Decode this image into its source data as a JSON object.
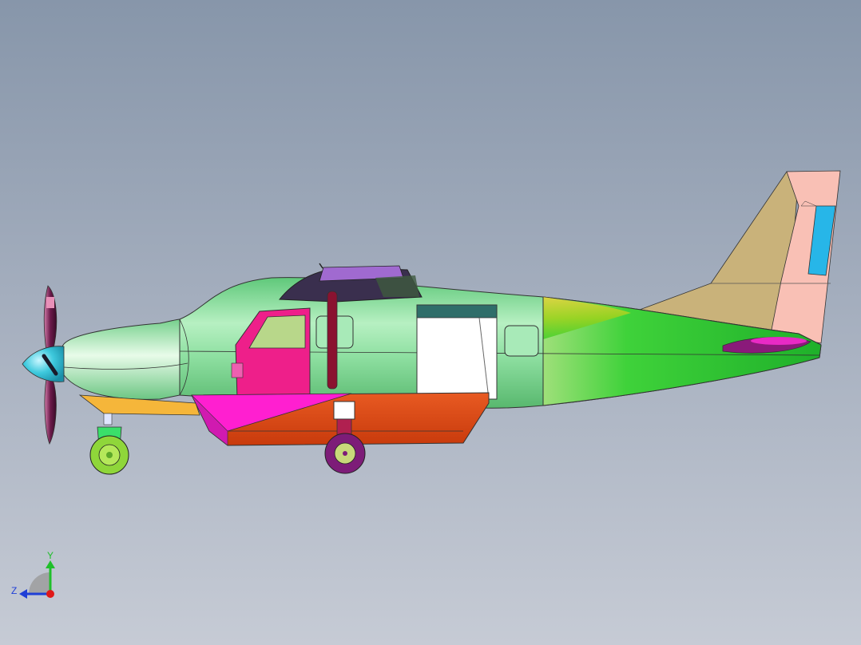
{
  "viewport": {
    "background_top": "#8796aa",
    "background_bottom": "#c6cbd5"
  },
  "model": {
    "colors": {
      "fuselage": "#8fe0a2",
      "fuselage_tail": "#3fd23a",
      "cowling": "#a9eab5",
      "spinner": "#3ec9dd",
      "propeller": "#6b1a4a",
      "door_front": "#ee1f8a",
      "door_window": "#b8d78a",
      "pod_pink": "#ff1fd0",
      "pod_orange": "#e24a17",
      "vertical_fin": "#c9b27a",
      "rudder": "#f9c0b5",
      "rudder_tab": "#27b6e8",
      "wheel_nose": "#8fd63a",
      "wheel_main": "#7d1c78",
      "canopy": "#5a4a6a",
      "strut": "#8a1230",
      "nose_fairing": "#f5b63a"
    }
  },
  "triad": {
    "y_label": "Y",
    "z_label": "Z",
    "y_color": "#1fbf2a",
    "z_color": "#1f3fd6",
    "x_color": "#e01818"
  }
}
